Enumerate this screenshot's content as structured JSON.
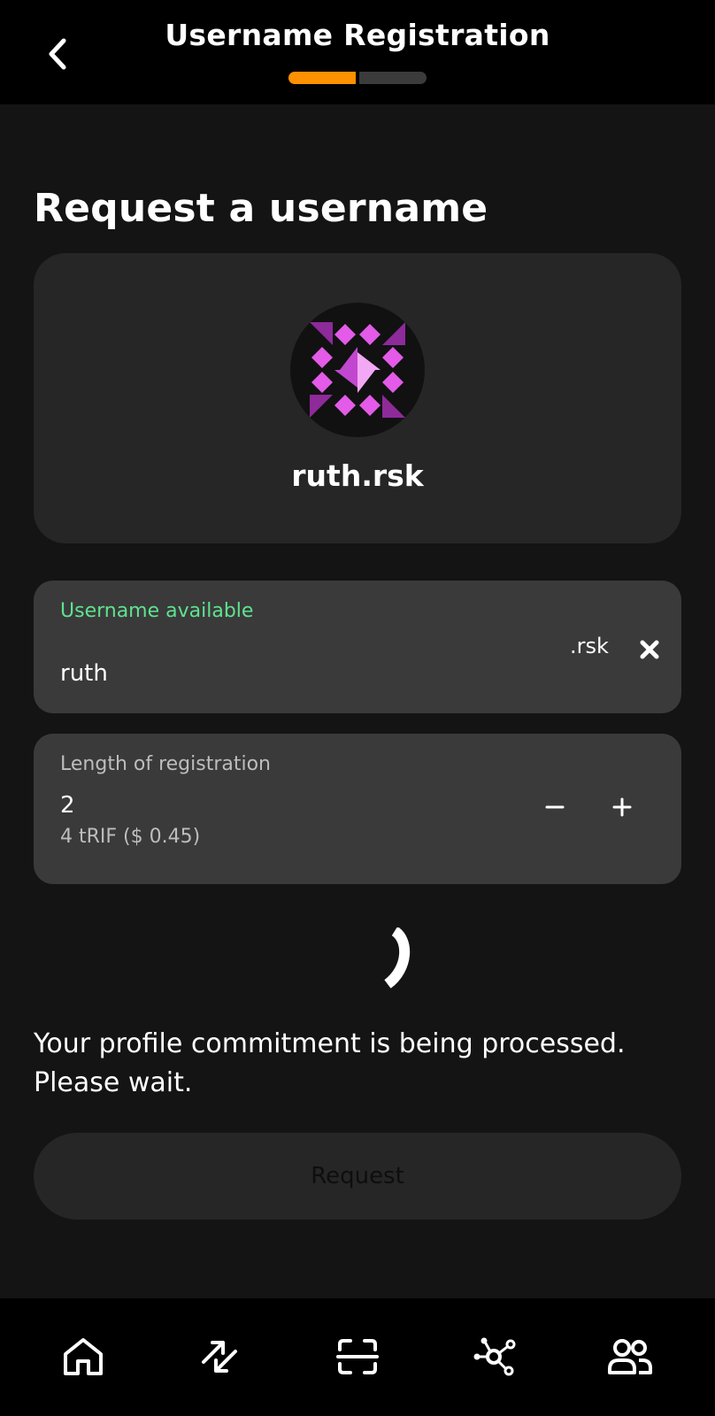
{
  "header": {
    "title": "Username Registration",
    "back_icon": "chevron-left-icon",
    "progress": {
      "current_step": 1,
      "total_steps": 2,
      "active_color": "#ff9100"
    }
  },
  "page": {
    "title": "Request a username"
  },
  "profile": {
    "avatar_icon": "identicon-avatar",
    "name": "ruth.rsk"
  },
  "username_field": {
    "status_label": "Username available",
    "status_color": "#5fe28f",
    "value": "ruth",
    "suffix": ".rsk",
    "clear_icon": "close-icon"
  },
  "registration_length": {
    "label": "Length of registration",
    "value": "2",
    "price": "4 tRIF ($ 0.45)",
    "decrement_icon": "minus-icon",
    "increment_icon": "plus-icon"
  },
  "status": {
    "message": "Your profile commitment is being processed. Please wait."
  },
  "request_button": {
    "label": "Request"
  },
  "bottom_nav": {
    "items": [
      {
        "icon": "home-icon"
      },
      {
        "icon": "transfer-icon"
      },
      {
        "icon": "scan-icon"
      },
      {
        "icon": "network-icon"
      },
      {
        "icon": "contacts-icon"
      }
    ]
  }
}
